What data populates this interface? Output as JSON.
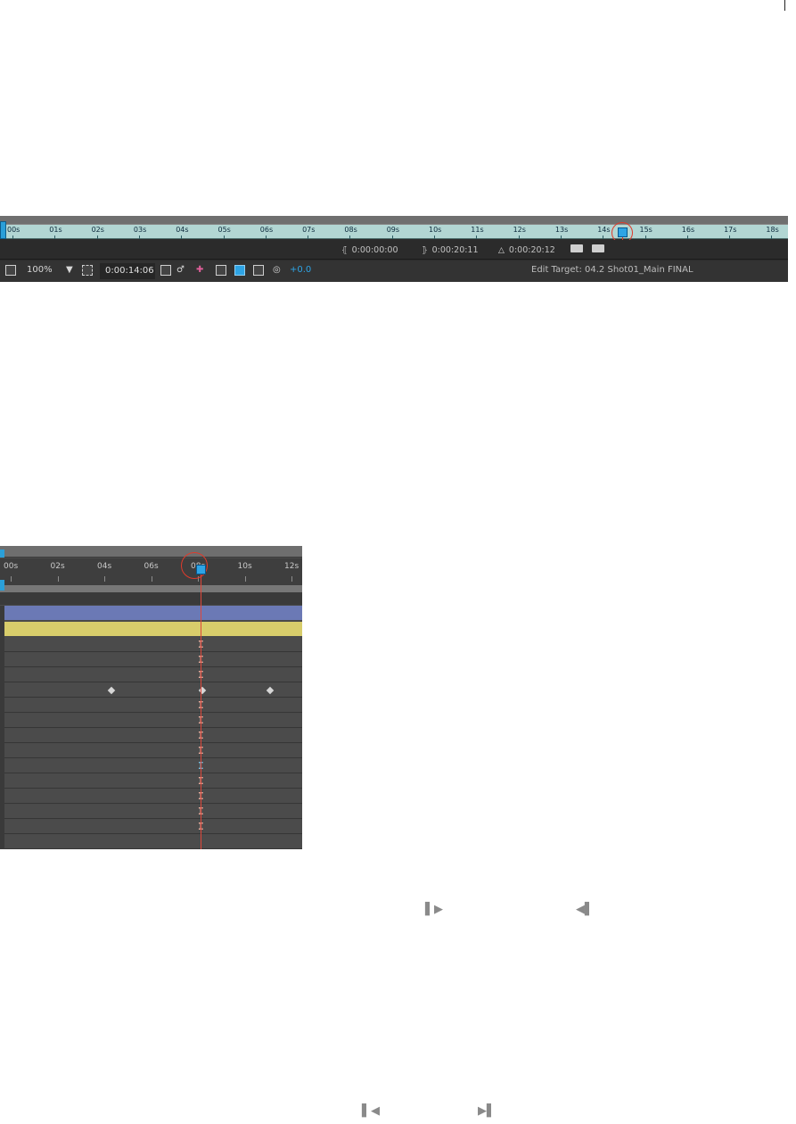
{
  "panel1": {
    "ruler_ticks": [
      "00s",
      "01s",
      "02s",
      "03s",
      "04s",
      "05s",
      "06s",
      "07s",
      "08s",
      "09s",
      "10s",
      "11s",
      "12s",
      "13s",
      "14s",
      "15s",
      "16s",
      "17s",
      "18s"
    ],
    "work_area_start": "0:00:00:00",
    "work_area_end": "0:00:20:11",
    "work_area_duration": "0:00:20:12",
    "zoom": "100%",
    "current_time": "0:00:14:06",
    "exposure": "+0.0",
    "edit_target": "Edit Target: 04.2 Shot01_Main FINAL",
    "colors": {
      "ruler": "#b2d6d3",
      "accent": "#2ea4e5",
      "cti": "#e23a28"
    },
    "icons": [
      "magnifier-icon",
      "dropdown-arrow-icon",
      "region-of-interest-icon",
      "snapshot-icon",
      "show-snapshot-icon",
      "channel-icon",
      "resolution-icon",
      "transparency-grid-icon",
      "3d-view-icon",
      "exposure-reset-icon"
    ]
  },
  "panel2": {
    "ruler_ticks": [
      "00s",
      "02s",
      "04s",
      "06s",
      "08s",
      "10s",
      "12s"
    ],
    "layers": [
      {
        "name": "layer-blue",
        "color": "#6b79b5"
      },
      {
        "name": "layer-yellow",
        "color": "#d8cd6b"
      }
    ],
    "property_rows": 14,
    "colors": {
      "cti": "#e0473a",
      "hold_keyframe": "#e8a89a",
      "selected_keyframe": "#7fb8d8"
    }
  },
  "nav_icons": {
    "go_to_next_keyframe": "next-keyframe-icon",
    "go_to_previous_keyframe": "previous-keyframe-icon",
    "go_to_first": "first-frame-icon",
    "go_to_last": "last-frame-icon"
  }
}
